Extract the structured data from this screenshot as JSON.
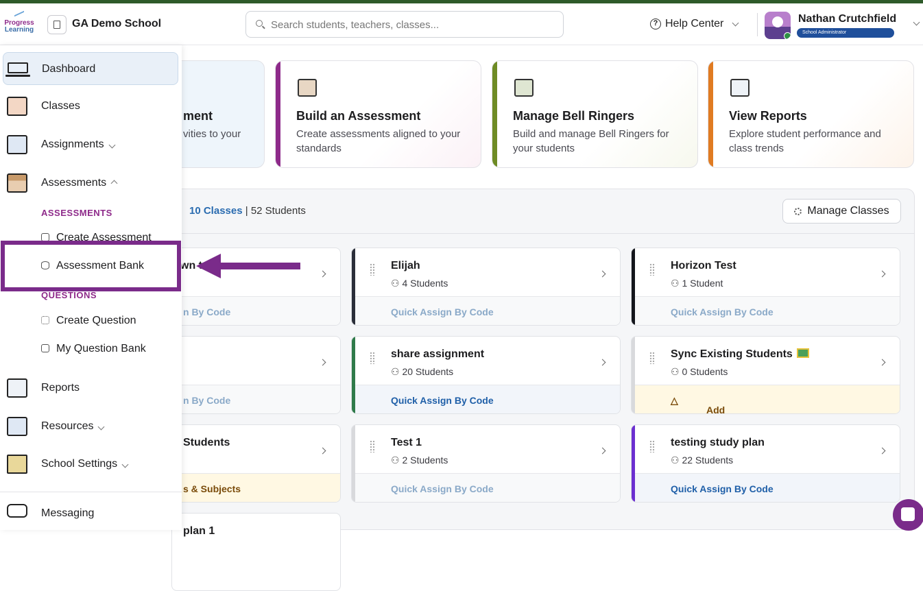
{
  "header": {
    "logo_line1": "Progress",
    "logo_line2": "Learning",
    "school_name": "GA Demo School",
    "search_placeholder": "Search students, teachers, classes...",
    "help_label": "Help Center",
    "user_name": "Nathan Crutchfield",
    "user_role": "School Administrator"
  },
  "sidebar": {
    "dashboard": "Dashboard",
    "classes": "Classes",
    "assignments": "Assignments",
    "assessments": "Assessments",
    "assessments_section": "ASSESSMENTS",
    "create_assessment": "Create Assessment",
    "assessment_bank": "Assessment Bank",
    "questions_section": "QUESTIONS",
    "create_question": "Create Question",
    "my_question_bank": "My Question Bank",
    "reports": "Reports",
    "resources": "Resources",
    "school_settings": "School Settings",
    "messaging": "Messaging"
  },
  "cards": [
    {
      "title": "ment",
      "desc": "vities to your"
    },
    {
      "title": "Build an Assessment",
      "desc": "Create assessments aligned to your standards"
    },
    {
      "title": "Manage Bell Ringers",
      "desc": "Build and manage Bell Ringers for your students"
    },
    {
      "title": "View Reports",
      "desc": "Explore student performance and class trends"
    }
  ],
  "classes_summary": {
    "classes_link": "10 Classes",
    "separator": "|",
    "students": "52 Students",
    "manage_button": "Manage Classes"
  },
  "class_cards": [
    {
      "name": "Elijah",
      "students": "4 Students",
      "action": "Quick Assign By Code"
    },
    {
      "name": "Horizon Test",
      "students": "1 Student",
      "action": "Quick Assign By Code"
    },
    {
      "name": "share assignment",
      "students": "20 Students",
      "action": "Quick Assign By Code"
    },
    {
      "name": "Sync Existing Students",
      "students": "0 Students",
      "action": "Add Students & Subjects"
    },
    {
      "name": "Test 1",
      "students": "2 Students",
      "action": "Quick Assign By Code"
    },
    {
      "name": "testing study plan",
      "students": "22 Students",
      "action": "Quick Assign By Code"
    }
  ],
  "partial_cards": [
    {
      "name": "wn t",
      "action": "n By Code"
    },
    {
      "name": "",
      "action": "n By Code"
    },
    {
      "name": "Students",
      "action": "s & Subjects"
    },
    {
      "name": "plan 1",
      "action": ""
    }
  ],
  "colors": {
    "brand_purple": "#7a2b8a",
    "link_blue": "#2b6cb0",
    "warn_bg": "#fff8e3"
  }
}
